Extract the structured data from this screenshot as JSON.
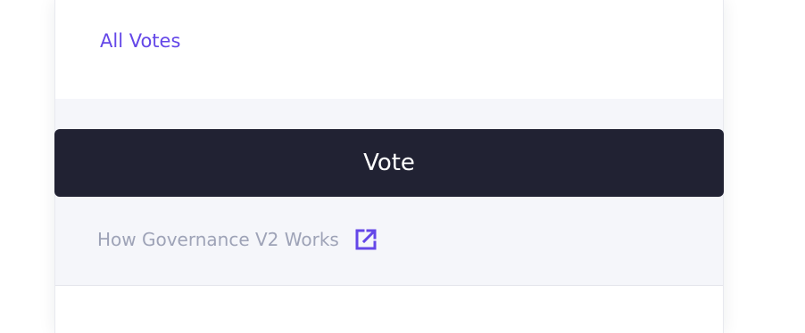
{
  "links": {
    "all_votes": "All Votes",
    "governance_works": "How Governance V2 Works"
  },
  "actions": {
    "vote_label": "Vote"
  },
  "icons": {
    "external_link": "external-link-icon"
  },
  "colors": {
    "accent": "#6447e8",
    "button_bg": "#212233",
    "button_text": "#ffffff",
    "muted_text": "#9ea3b7",
    "section_bg": "#f5f6fa"
  }
}
